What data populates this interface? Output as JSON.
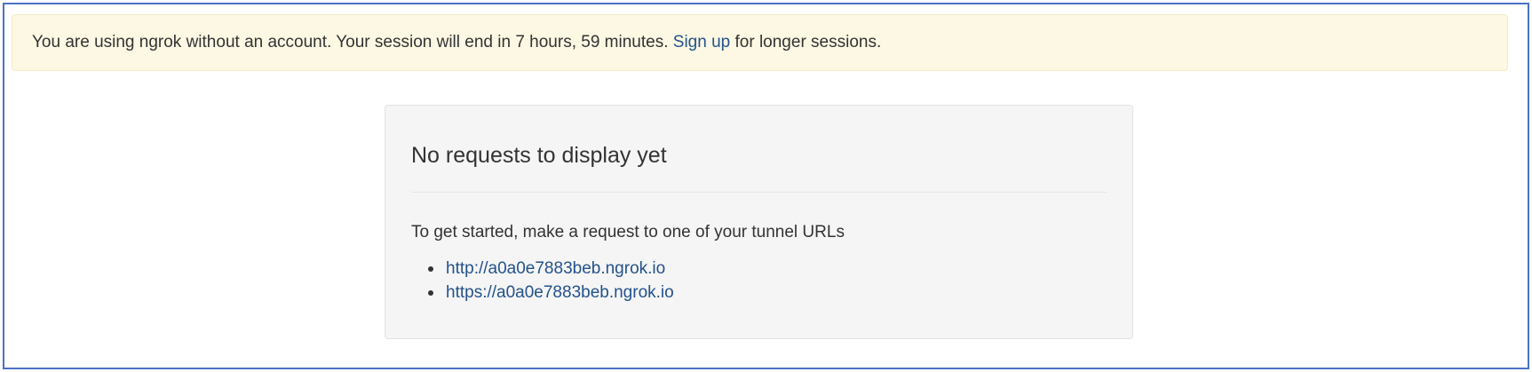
{
  "alert": {
    "text_before": "You are using ngrok without an account. Your session will end in 7 hours, 59 minutes.",
    "signup_link": "Sign up",
    "text_after": "for longer sessions."
  },
  "panel": {
    "title": "No requests to display yet",
    "intro": "To get started, make a request to one of your tunnel URLs",
    "urls": [
      "http://a0a0e7883beb.ngrok.io",
      "https://a0a0e7883beb.ngrok.io"
    ]
  },
  "colors": {
    "alert_background": "#fcf8e3",
    "link": "#23528c",
    "panel_background": "#f5f5f5",
    "frame_border": "#4a72c4"
  }
}
